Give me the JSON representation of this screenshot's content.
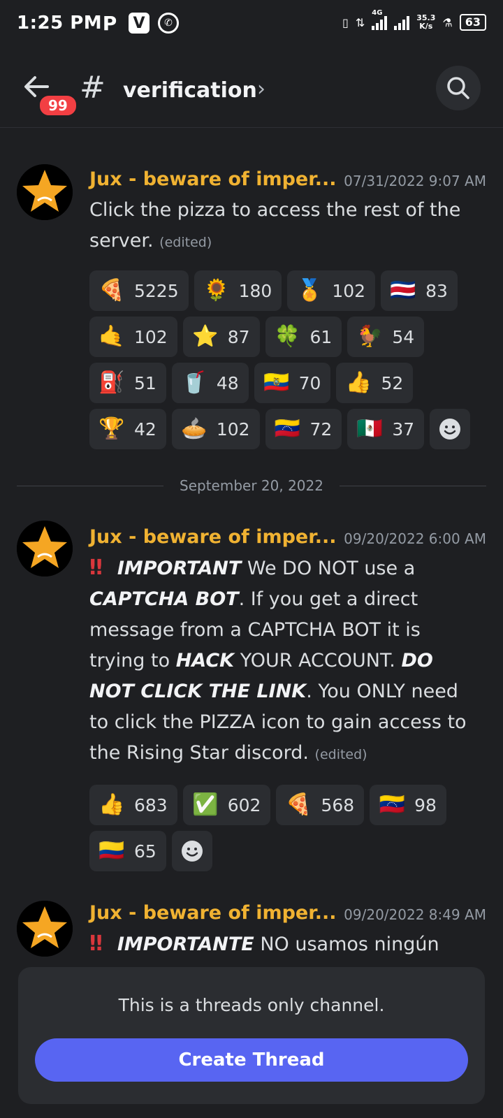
{
  "status_bar": {
    "time": "1:25 PM",
    "apps": [
      "P",
      "V",
      "whatsapp-icon"
    ],
    "network": "4G",
    "speed": "35.3",
    "speed_unit": "K/s",
    "battery": "63"
  },
  "header": {
    "badge": "99",
    "hash": "#",
    "channel_name": "verification",
    "chevron": "›"
  },
  "messages": [
    {
      "author": "Jux - beware of imper...",
      "timestamp": "07/31/2022 9:07 AM",
      "text": "Click the pizza to access the rest of the server.",
      "edited": "(edited)",
      "reactions": [
        {
          "emoji": "🍕",
          "count": "5225"
        },
        {
          "emoji": "🌻",
          "count": "180"
        },
        {
          "emoji": "🏅",
          "count": "102"
        },
        {
          "emoji": "🇨🇷",
          "count": "83"
        },
        {
          "emoji": "🤙",
          "count": "102"
        },
        {
          "emoji": "⭐",
          "count": "87"
        },
        {
          "emoji": "🍀",
          "count": "61"
        },
        {
          "emoji": "🐓",
          "count": "54"
        },
        {
          "emoji": "⛽",
          "count": "51"
        },
        {
          "emoji": "🥤",
          "count": "48"
        },
        {
          "emoji": "🇪🇨",
          "count": "70"
        },
        {
          "emoji": "👍",
          "count": "52"
        },
        {
          "emoji": "🏆",
          "count": "42"
        },
        {
          "emoji": "🥧",
          "count": "102"
        },
        {
          "emoji": "🇻🇪",
          "count": "72"
        },
        {
          "emoji": "🇲🇽",
          "count": "37"
        }
      ]
    },
    {
      "author": "Jux - beware of imper...",
      "timestamp": "09/20/2022 6:00 AM",
      "bang": "‼",
      "important": "IMPORTANT",
      "t1": " We DO NOT use a ",
      "captcha": "CAPTCHA BOT",
      "t2": ". If you get a direct message from a CAPTCHA BOT it is trying to ",
      "hack": "HACK",
      "t3": " YOUR ACCOUNT. ",
      "donot": "DO NOT CLICK THE LINK",
      "t4": ". You ONLY need to click the PIZZA icon to gain access to the Rising Star discord.",
      "edited": "(edited)",
      "reactions": [
        {
          "emoji": "👍",
          "count": "683"
        },
        {
          "emoji": "✅",
          "count": "602"
        },
        {
          "emoji": "🍕",
          "count": "568"
        },
        {
          "emoji": "🇻🇪",
          "count": "98"
        },
        {
          "emoji": "🇨🇴",
          "count": "65"
        }
      ]
    },
    {
      "author": "Jux - beware of imper...",
      "timestamp": "09/20/2022 8:49 AM",
      "bang": "‼",
      "important": "IMPORTANTE",
      "t1": " NO usamos ningún"
    }
  ],
  "date_divider": "September 20, 2022",
  "footer": {
    "notice": "This is a threads only channel.",
    "button": "Create Thread"
  },
  "colors": {
    "background": "#1e1f22",
    "author": "#f0b232",
    "accent": "#5865f2",
    "badge": "#f23f43"
  }
}
